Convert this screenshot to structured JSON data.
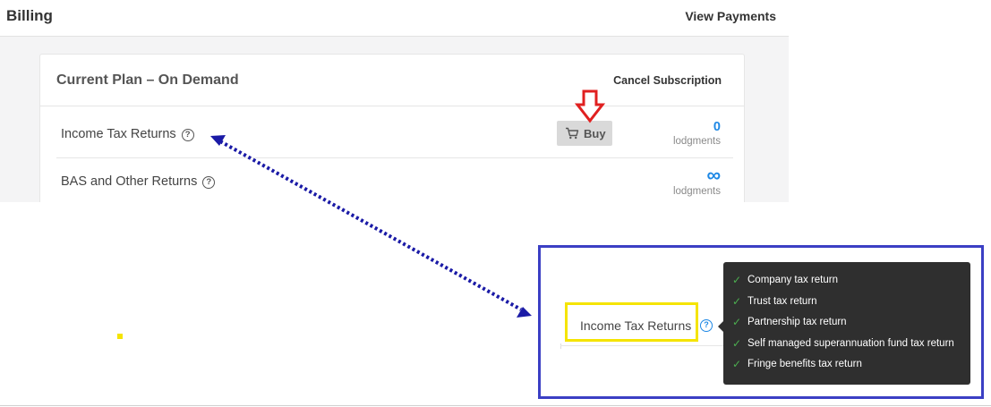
{
  "header": {
    "title": "Billing",
    "view_payments": "View Payments"
  },
  "plan": {
    "title": "Current Plan – On Demand",
    "cancel_label": "Cancel Subscription",
    "rows": [
      {
        "label": "Income Tax Returns",
        "count": "0",
        "unit": "lodgments",
        "buy_label": "Buy"
      },
      {
        "label": "BAS and Other Returns",
        "count": "∞",
        "unit": "lodgments"
      }
    ]
  },
  "zoom": {
    "label": "Income Tax Returns",
    "help_glyph": "?",
    "tooltip_items": [
      "Company tax return",
      "Trust tax return",
      "Partnership tax return",
      "Self managed superannuation fund tax return",
      "Fringe benefits tax return"
    ]
  },
  "icons": {
    "help": "question-circle-icon",
    "cart": "cart-icon",
    "check": "check-icon",
    "arrow": "down-arrow-icon"
  },
  "colors": {
    "accent": "#1e88e5",
    "annotation_arrow": "#e02020",
    "connector": "#1a1aa6",
    "zoom_border": "#3b3fc4",
    "highlight": "#f5e400",
    "tooltip_bg": "#2f2f2f",
    "check": "#4caf50"
  }
}
